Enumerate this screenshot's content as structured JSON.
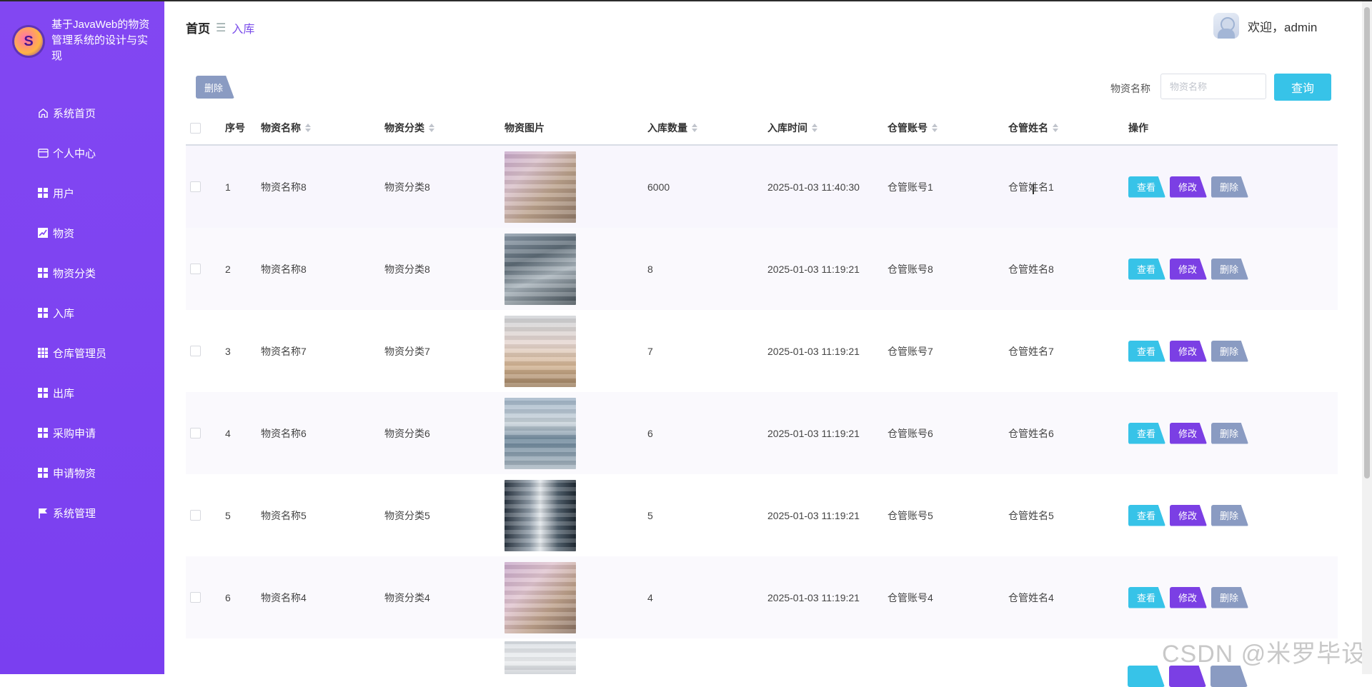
{
  "brand": {
    "title": "基于JavaWeb的物资管理系统的设计与实现"
  },
  "sidebar": {
    "items": [
      {
        "label": "系统首页",
        "icon": "home-icon"
      },
      {
        "label": "个人中心",
        "icon": "card-icon"
      },
      {
        "label": "用户",
        "icon": "grid-icon"
      },
      {
        "label": "物资",
        "icon": "chart-icon"
      },
      {
        "label": "物资分类",
        "icon": "grid-icon"
      },
      {
        "label": "入库",
        "icon": "grid-icon"
      },
      {
        "label": "仓库管理员",
        "icon": "grid9-icon"
      },
      {
        "label": "出库",
        "icon": "grid-icon"
      },
      {
        "label": "采购申请",
        "icon": "grid-icon"
      },
      {
        "label": "申请物资",
        "icon": "grid-icon"
      },
      {
        "label": "系统管理",
        "icon": "flag-icon"
      }
    ]
  },
  "header": {
    "breadcrumb_home": "首页",
    "breadcrumb_sep": "☰",
    "breadcrumb_current": "入库",
    "welcome": "欢迎，admin"
  },
  "toolbar": {
    "batch_delete_label": "删除",
    "search_label": "物资名称",
    "search_placeholder": "物资名称",
    "search_button": "查询"
  },
  "table": {
    "headers": {
      "index": "序号",
      "name": "物资名称",
      "category": "物资分类",
      "image": "物资图片",
      "qty": "入库数量",
      "time": "入库时间",
      "account": "仓管账号",
      "uname": "仓管姓名",
      "op": "操作"
    },
    "rows": [
      {
        "index": "1",
        "name": "物资名称8",
        "category": "物资分类8",
        "qty": "6000",
        "time": "2025-01-03 11:40:30",
        "account": "仓管账号1",
        "uname": "仓管姓名1"
      },
      {
        "index": "2",
        "name": "物资名称8",
        "category": "物资分类8",
        "qty": "8",
        "time": "2025-01-03 11:19:21",
        "account": "仓管账号8",
        "uname": "仓管姓名8"
      },
      {
        "index": "3",
        "name": "物资名称7",
        "category": "物资分类7",
        "qty": "7",
        "time": "2025-01-03 11:19:21",
        "account": "仓管账号7",
        "uname": "仓管姓名7"
      },
      {
        "index": "4",
        "name": "物资名称6",
        "category": "物资分类6",
        "qty": "6",
        "time": "2025-01-03 11:19:21",
        "account": "仓管账号6",
        "uname": "仓管姓名6"
      },
      {
        "index": "5",
        "name": "物资名称5",
        "category": "物资分类5",
        "qty": "5",
        "time": "2025-01-03 11:19:21",
        "account": "仓管账号5",
        "uname": "仓管姓名5"
      },
      {
        "index": "6",
        "name": "物资名称4",
        "category": "物资分类4",
        "qty": "4",
        "time": "2025-01-03 11:19:21",
        "account": "仓管账号4",
        "uname": "仓管姓名4"
      }
    ],
    "actions": {
      "view": "查看",
      "edit": "修改",
      "delete": "删除"
    }
  },
  "watermark": "CSDN @米罗毕设",
  "colors": {
    "sidebar": "#7f44f1",
    "accent": "#7a4dea",
    "view_button": "#37c3e8",
    "edit_button": "#7b3fe4",
    "delete_button": "#8a9bc2"
  }
}
